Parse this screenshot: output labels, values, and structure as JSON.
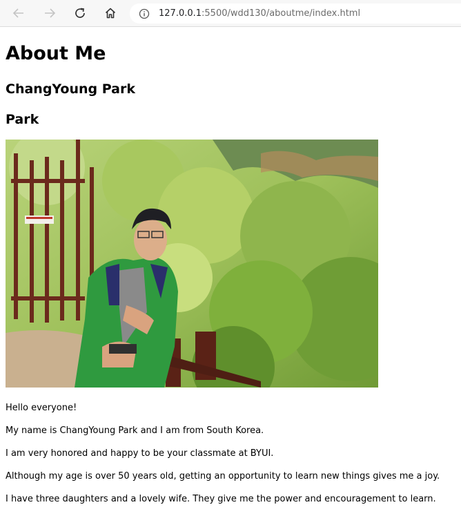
{
  "browser": {
    "url_host": "127.0.0.1",
    "url_rest": ":5500/wdd130/aboutme/index.html"
  },
  "page": {
    "title": "About Me",
    "name": "ChangYoung Park",
    "surname": "Park",
    "paragraphs": [
      "Hello everyone!",
      "My name is ChangYoung Park and I am from South Korea.",
      "I am very honored and happy to be your classmate at BYUI.",
      "Although my age is over 50 years old, getting an opportunity to learn new things gives me a joy.",
      "I have three daughters and a lovely wife. They give me the power and encouragement to learn."
    ]
  },
  "colors": {
    "toolbar_bg": "#f7f7f7",
    "page_bg": "#ffffff",
    "jacket_green": "#2f9a3f"
  }
}
